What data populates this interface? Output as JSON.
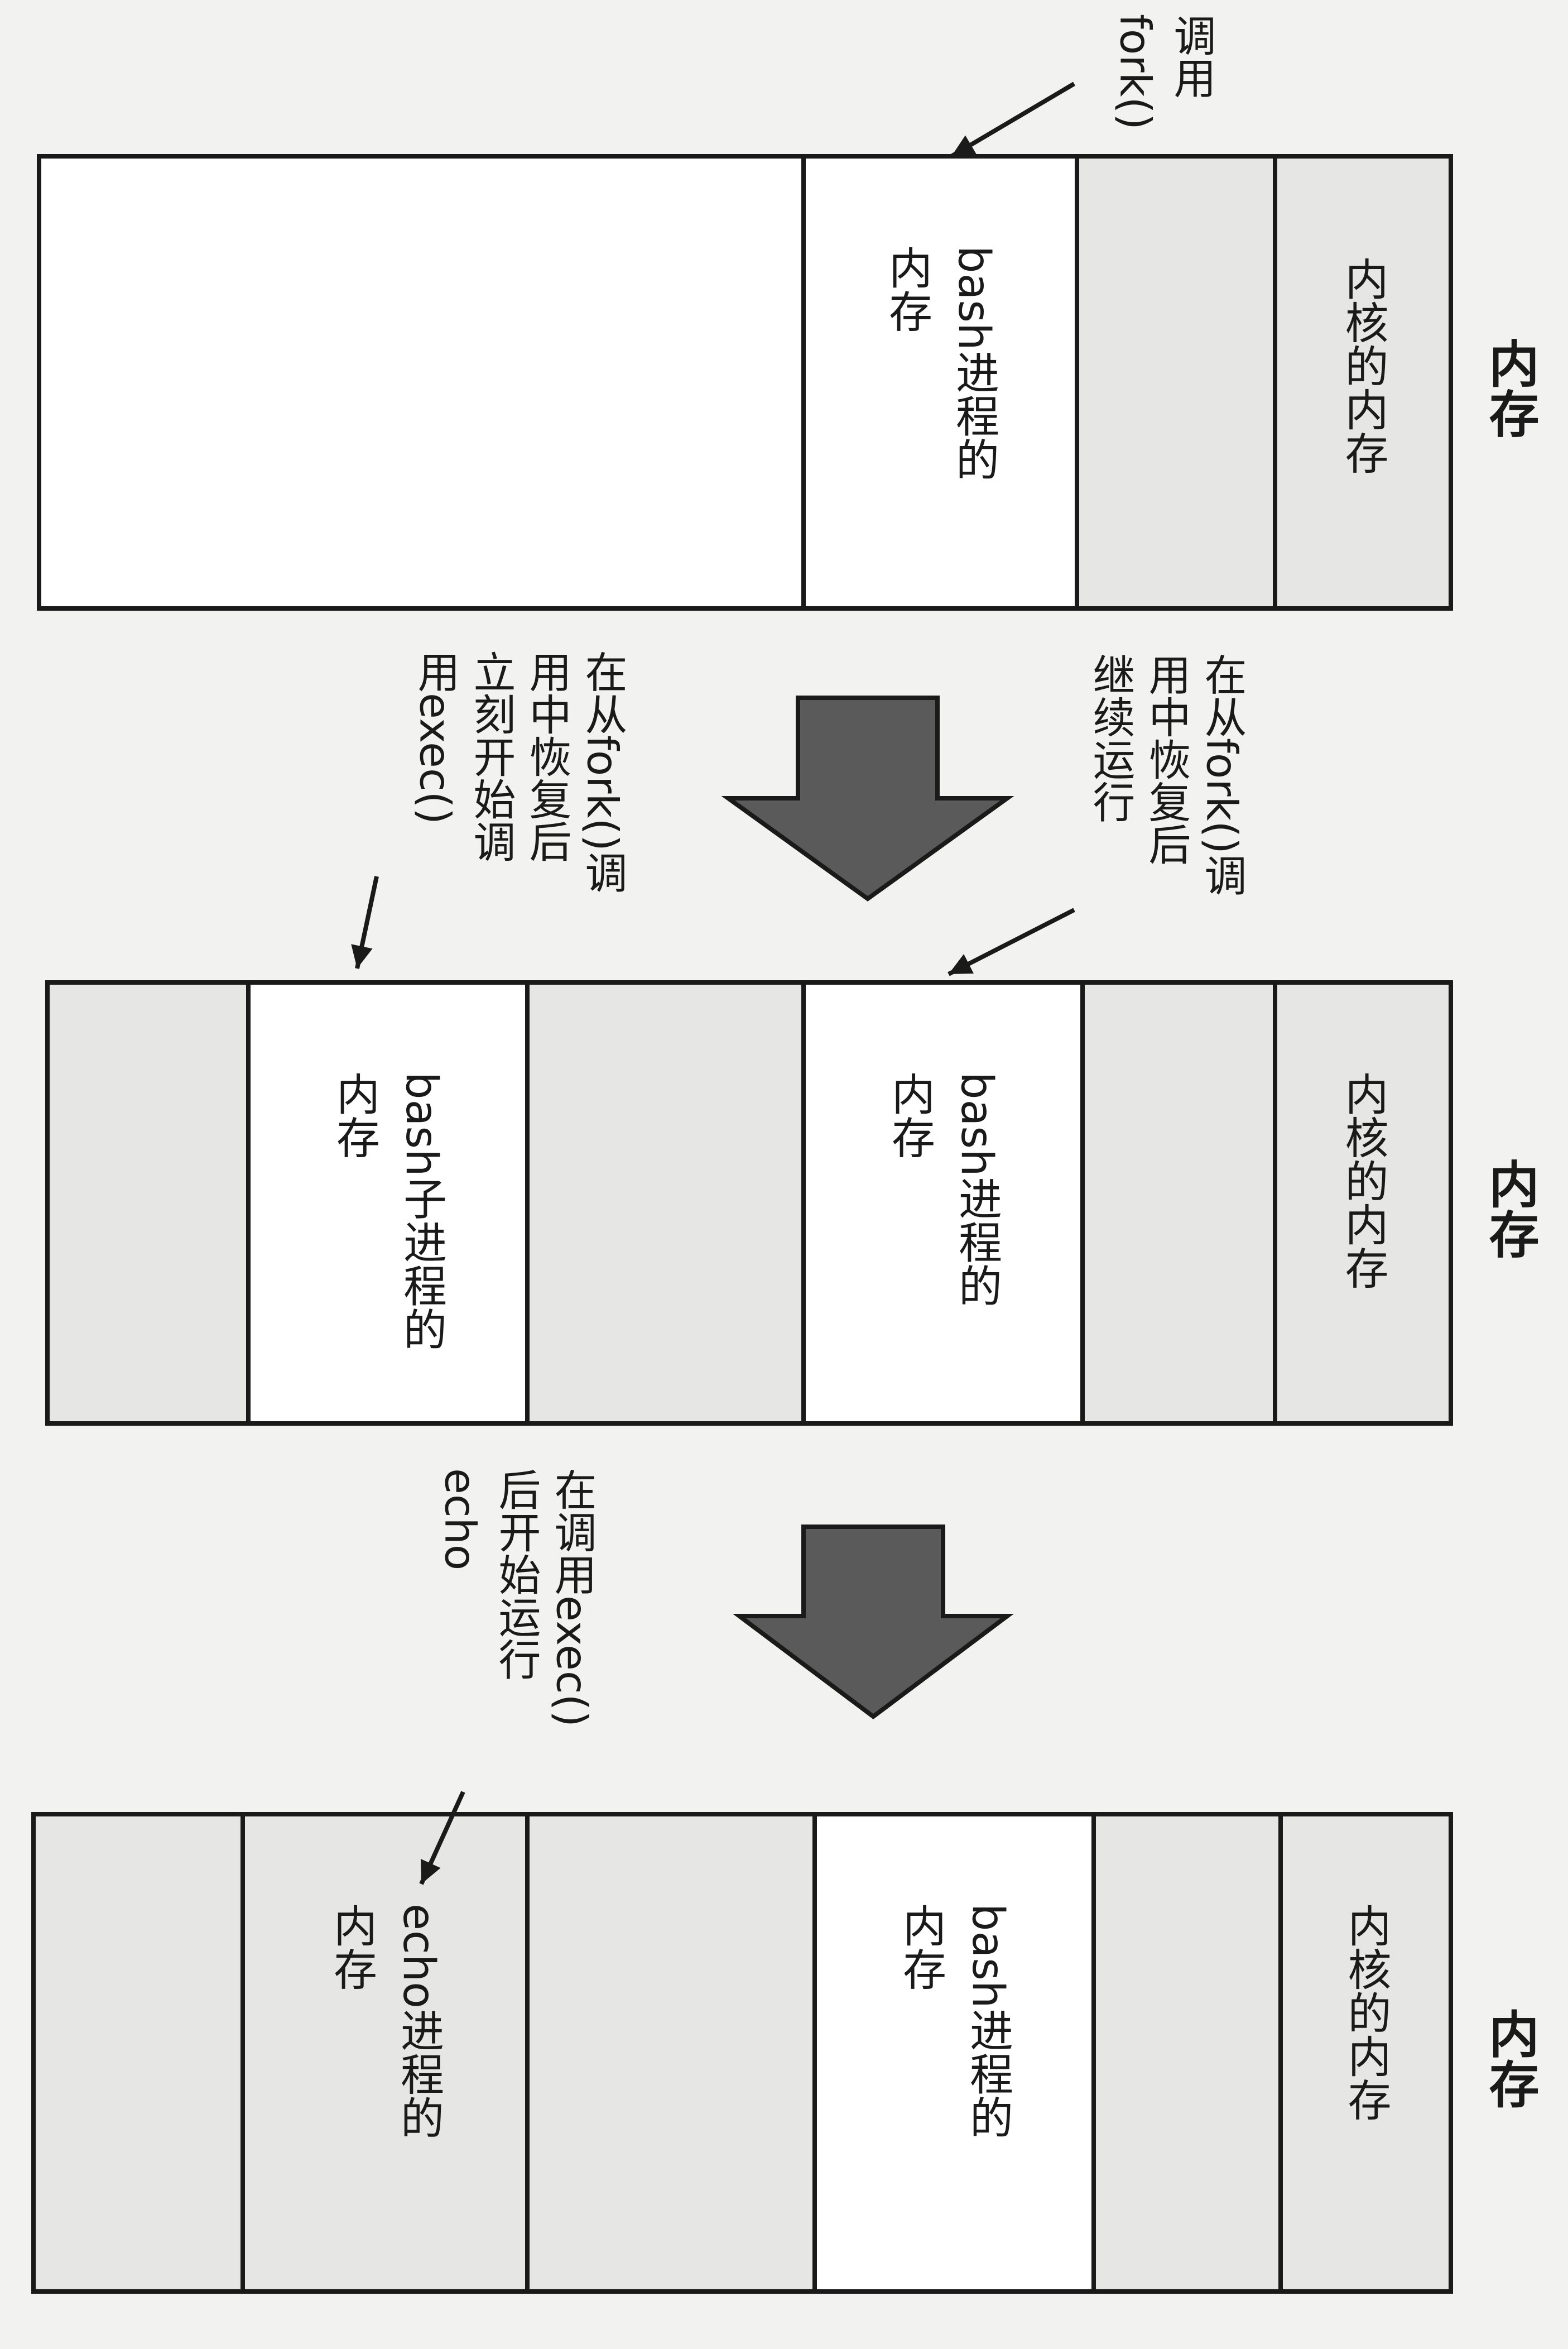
{
  "memory_label": "内存",
  "colors": {
    "white": "#ffffff",
    "shaded": "#e6e6e4",
    "arrow": "#5a5a5a",
    "line": "#1a1a1a"
  },
  "stages": [
    {
      "id": "stage1",
      "segments": [
        {
          "fill": "shaded",
          "lines": [
            "内核的内存"
          ]
        },
        {
          "fill": "shaded",
          "lines": []
        },
        {
          "fill": "white",
          "lines": [
            "bash进程的",
            "内存"
          ]
        },
        {
          "fill": "white",
          "lines": []
        }
      ]
    },
    {
      "id": "stage2",
      "segments": [
        {
          "fill": "shaded",
          "lines": [
            "内核的内存"
          ]
        },
        {
          "fill": "shaded",
          "lines": []
        },
        {
          "fill": "white",
          "lines": [
            "bash进程的",
            "内存"
          ]
        },
        {
          "fill": "shaded",
          "lines": []
        },
        {
          "fill": "white",
          "lines": [
            "bash子进程的",
            "内存"
          ]
        },
        {
          "fill": "shaded",
          "lines": []
        }
      ]
    },
    {
      "id": "stage3",
      "segments": [
        {
          "fill": "shaded",
          "lines": [
            "内核的内存"
          ]
        },
        {
          "fill": "shaded",
          "lines": []
        },
        {
          "fill": "white",
          "lines": [
            "bash进程的",
            "内存"
          ]
        },
        {
          "fill": "shaded",
          "lines": []
        },
        {
          "fill": "shaded",
          "lines": [
            "echo进程的",
            "内存"
          ]
        },
        {
          "fill": "shaded",
          "lines": []
        }
      ]
    }
  ],
  "annotations": {
    "call_fork": [
      "调用",
      "fork()"
    ],
    "parent_resume": [
      "在从fork()调",
      "用中恢复后",
      "继续运行"
    ],
    "child_resume": [
      "在从fork()调",
      "用中恢复后",
      "立刻开始调",
      "用exec()"
    ],
    "after_exec": [
      "在调用exec()",
      "后开始运行",
      "echo"
    ]
  }
}
